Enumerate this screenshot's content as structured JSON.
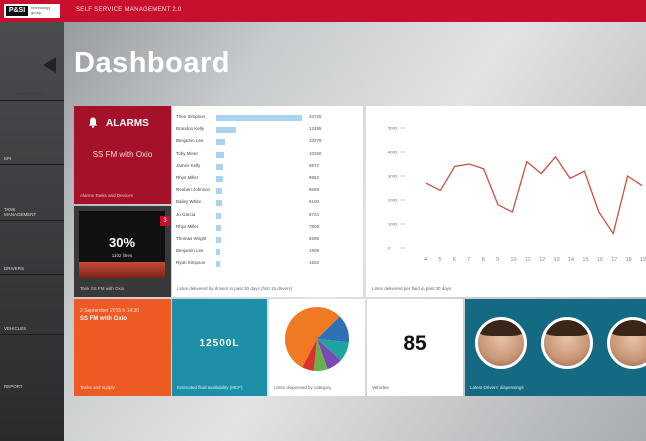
{
  "topbar": {
    "logo_mark": "P&SI",
    "logo_text": "technology group",
    "app_title": "SELF SERVICE MANAGEMENT 2.0"
  },
  "sidebar": {
    "breadcrumb": "DASHBOARD",
    "items": [
      {
        "label": "KPI"
      },
      {
        "label": "TANK\nMANAGEMENT"
      },
      {
        "label": "DRIVERS"
      },
      {
        "label": "VEHICLES"
      },
      {
        "label": "REPORT"
      }
    ]
  },
  "header": {
    "title": "Dashboard"
  },
  "alarms": {
    "title": "ALARMS",
    "subtitle": "SS FM with Oxio",
    "footer": "Alarms Tanks and Devices"
  },
  "fuel": {
    "percent": "30%",
    "liters": "1102 litres",
    "badge": "3",
    "footer": "Tank SS FM with Oxio",
    "fill_fraction": 0.3
  },
  "drivers": {
    "footer": "Litres delivered by drivers in past 30 days (first 15 drivers)",
    "rows": [
      {
        "name": "Theo Simpson",
        "value": "34725",
        "fraction": 0.95
      },
      {
        "name": "Brandon Kelly",
        "value": "12495",
        "fraction": 0.22
      },
      {
        "name": "Benjamin Lee",
        "value": "10278",
        "fraction": 0.1
      },
      {
        "name": "Toby Miner",
        "value": "10260",
        "fraction": 0.09
      },
      {
        "name": "James Kelly",
        "value": "9872",
        "fraction": 0.08
      },
      {
        "name": "Rhys Miller",
        "value": "9852",
        "fraction": 0.08
      },
      {
        "name": "Reuben Johnson",
        "value": "9668",
        "fraction": 0.07
      },
      {
        "name": "Bailey White",
        "value": "9190",
        "fraction": 0.07
      },
      {
        "name": "Jo Garcia",
        "value": "8724",
        "fraction": 0.06
      },
      {
        "name": "Rhys Miller",
        "value": "7809",
        "fraction": 0.06
      },
      {
        "name": "Thomas Wright",
        "value": "5998",
        "fraction": 0.05
      },
      {
        "name": "Benjamin Lee",
        "value": "1909",
        "fraction": 0.04
      },
      {
        "name": "Ryan Simpson",
        "value": "1502",
        "fraction": 0.04
      }
    ]
  },
  "line_chart": {
    "footer": "Litres delivered per fluid in past 30 days",
    "ytick_labels": [
      "5000",
      "4000",
      "3000",
      "2000",
      "1000",
      "0"
    ],
    "xtick_labels": [
      "4",
      "5",
      "6",
      "7",
      "8",
      "9",
      "10",
      "11",
      "12",
      "13",
      "14",
      "15",
      "16",
      "17",
      "18",
      "19"
    ]
  },
  "last_refill": {
    "date": "2 September 2015 h 14:30",
    "tank": "SS FM with Oxio",
    "footer": "Tanks and supply"
  },
  "availability": {
    "value": "12500L",
    "footer": "Estimated fluid availability (MCF)"
  },
  "pie": {
    "footer": "Litres dispensed by category"
  },
  "vehicles": {
    "value": "85",
    "footer": "Vehicles"
  },
  "latest": {
    "footer": "Latest Drivers' dispensings"
  },
  "chart_data": [
    {
      "type": "bar",
      "title": "",
      "xlabel": "",
      "ylabel": "",
      "categories": [
        "Theo Simpson",
        "Brandon Kelly",
        "Benjamin Lee",
        "Toby Miner",
        "James Kelly",
        "Rhys Miller",
        "Reuben Johnson",
        "Bailey White",
        "Jo Garcia",
        "Rhys Miller",
        "Thomas Wright",
        "Benjamin Lee",
        "Ryan Simpson"
      ],
      "values": [
        34725,
        12495,
        10278,
        10260,
        9872,
        9852,
        9668,
        9190,
        8724,
        7809,
        5998,
        1909,
        1502
      ]
    },
    {
      "type": "line",
      "title": "",
      "xlabel": "",
      "ylabel": "",
      "x": [
        4,
        5,
        6,
        7,
        8,
        9,
        10,
        11,
        12,
        13,
        14,
        15,
        16,
        17,
        18,
        19
      ],
      "y": [
        2700,
        2400,
        3400,
        3500,
        3300,
        1800,
        1500,
        3600,
        3100,
        3800,
        2900,
        3200,
        1500,
        600,
        3000,
        2600
      ],
      "ylim": [
        0,
        5000
      ],
      "color": "#c9503f"
    },
    {
      "type": "pie",
      "labels": [
        "orange",
        "blue",
        "teal",
        "purple",
        "green",
        "red"
      ],
      "values": [
        55,
        14,
        10,
        8,
        7,
        6
      ],
      "colors": [
        "#f07a24",
        "#2e6fb6",
        "#1ea3a3",
        "#7a4bb0",
        "#6ab04c",
        "#d9342b"
      ]
    }
  ]
}
